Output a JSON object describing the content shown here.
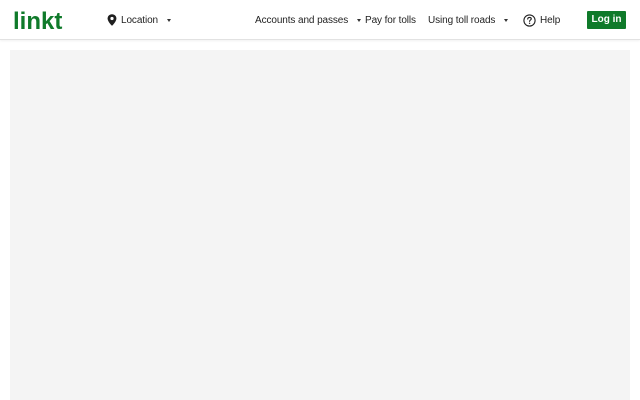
{
  "brand": {
    "logo_text": "linkt",
    "logo_color": "#0f7a2a"
  },
  "nav": {
    "location": {
      "label": "Location",
      "icon": "map-pin-icon",
      "has_dropdown": true
    },
    "accounts": {
      "label": "Accounts and passes",
      "has_dropdown": true
    },
    "pay": {
      "label": "Pay for tolls",
      "has_dropdown": false
    },
    "using": {
      "label": "Using toll roads",
      "has_dropdown": true
    },
    "help": {
      "label": "Help",
      "icon": "help-circle-icon"
    }
  },
  "login": {
    "label": "Log in",
    "background": "#0f7a2a"
  },
  "content": {
    "background": "#f4f4f4"
  }
}
